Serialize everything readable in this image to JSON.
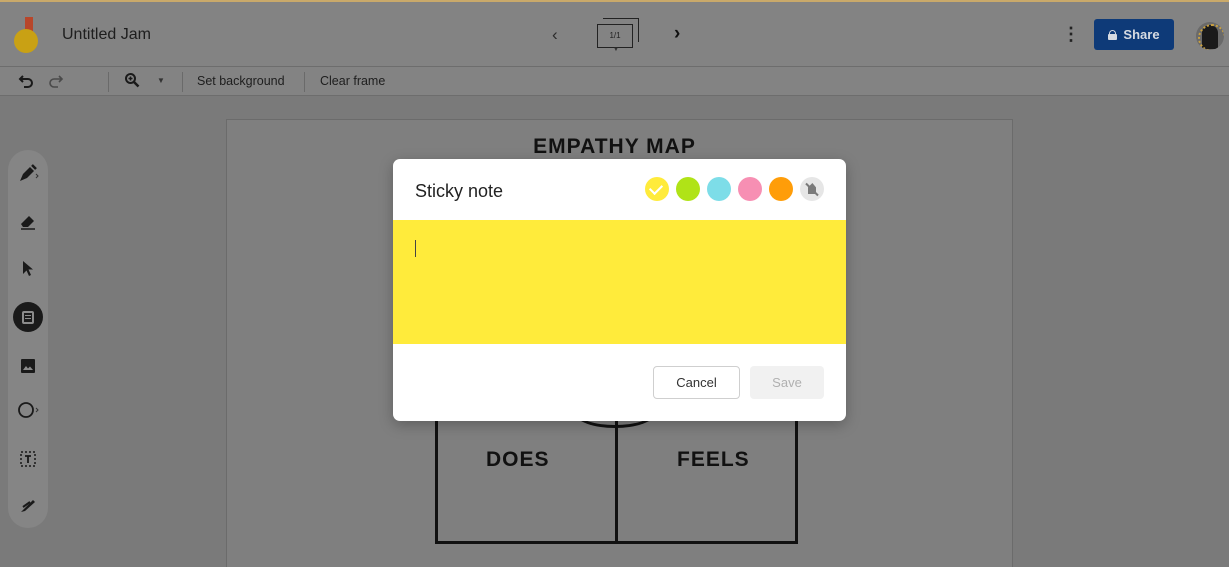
{
  "app": {
    "document_title": "Untitled Jam",
    "frame_indicator": "1/1",
    "share_label": "Share"
  },
  "toolbar": {
    "set_background_label": "Set background",
    "clear_frame_label": "Clear frame"
  },
  "board": {
    "title": "EMPATHY MAP",
    "quadrants": [
      "DOES",
      "FEELS"
    ]
  },
  "tools": [
    {
      "icon": "pen-icon"
    },
    {
      "icon": "eraser-icon"
    },
    {
      "icon": "select-arrow-icon"
    },
    {
      "icon": "sticky-note-icon",
      "active": true
    },
    {
      "icon": "image-icon"
    },
    {
      "icon": "circle-shape-icon"
    },
    {
      "icon": "text-box-icon"
    },
    {
      "icon": "laser-pointer-icon"
    }
  ],
  "dialog": {
    "title": "Sticky note",
    "colors": [
      {
        "name": "yellow",
        "hex": "#ffeb3b",
        "selected": true
      },
      {
        "name": "green",
        "hex": "#b0e317"
      },
      {
        "name": "blue",
        "hex": "#7ddde8"
      },
      {
        "name": "pink",
        "hex": "#f78fb3"
      },
      {
        "name": "orange",
        "hex": "#ff9d09"
      }
    ],
    "note_color": "#ffeb3b",
    "note_text": "",
    "cancel_label": "Cancel",
    "save_label": "Save"
  }
}
